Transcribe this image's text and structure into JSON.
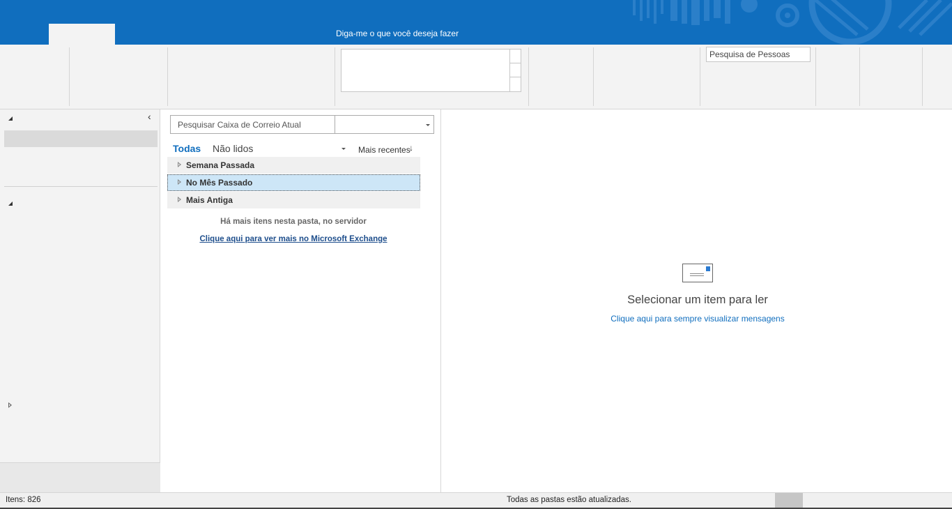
{
  "titlebar": {
    "tell_me": "Diga-me o que você deseja fazer",
    "accent_color": "#106ebe"
  },
  "ribbon": {
    "people_search": "Pesquisa de Pessoas"
  },
  "search": {
    "mailbox_placeholder": "Pesquisar Caixa de Correio Atual",
    "scope_value": ""
  },
  "filters": {
    "all": "Todas",
    "unread": "Não lidos",
    "sort": "Mais recentes",
    "sort_icon": "↓"
  },
  "groups": [
    {
      "label": "Semana Passada"
    },
    {
      "label": "No Mês Passado",
      "selected": true
    },
    {
      "label": "Mais Antiga"
    }
  ],
  "message_list": {
    "more_items": "Há mais itens nesta pasta, no servidor",
    "more_link": "Clique aqui para ver mais no Microsoft Exchange"
  },
  "reading_pane": {
    "title": "Selecionar um item para ler",
    "link": "Clique aqui para sempre visualizar mensagens"
  },
  "status": {
    "items": "Itens: 826",
    "sync": "Todas as pastas estão atualizadas."
  }
}
